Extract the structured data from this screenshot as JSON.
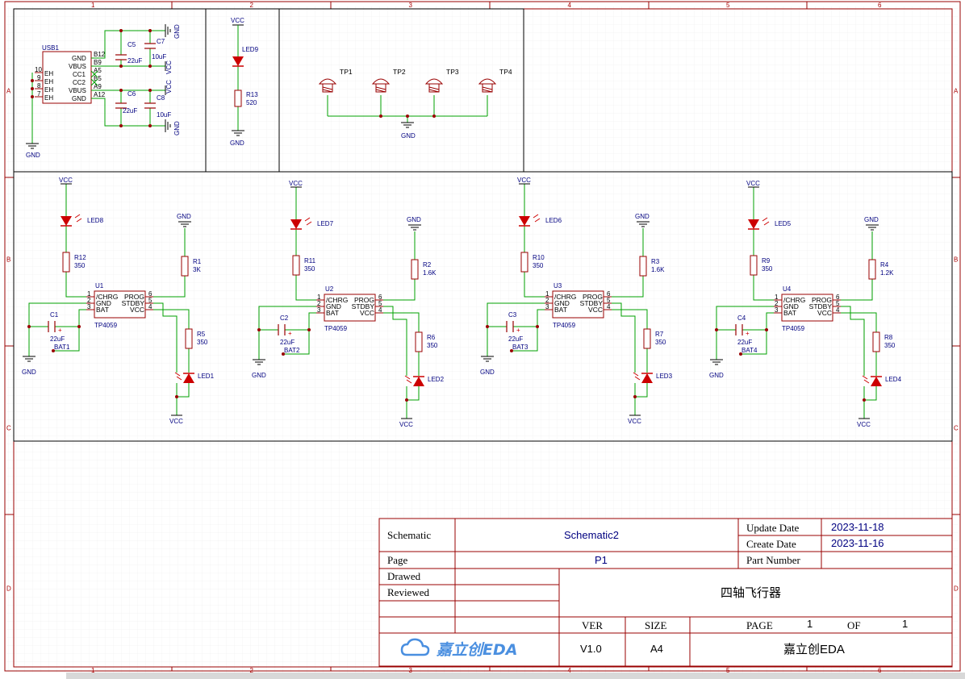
{
  "grid": {
    "columns": [
      "1",
      "2",
      "3",
      "4",
      "5",
      "6"
    ],
    "rows": [
      "A",
      "B",
      "C",
      "D"
    ]
  },
  "power_labels": {
    "vcc": "VCC",
    "gnd": "GND"
  },
  "usb": {
    "ref": "USB1",
    "left_pins": [
      "10",
      "9",
      "8",
      "7"
    ],
    "left_names": [
      "EH",
      "EH",
      "EH",
      "EH"
    ],
    "inner_names": [
      "GND",
      "VBUS",
      "CC1",
      "CC2",
      "VBUS",
      "GND"
    ],
    "right_pins": [
      "B12",
      "B9",
      "A5",
      "B5",
      "A9",
      "A12"
    ],
    "caps": [
      {
        "ref": "C5",
        "value": "22uF"
      },
      {
        "ref": "C7",
        "value": "10uF"
      },
      {
        "ref": "C6",
        "value": "22uF"
      },
      {
        "ref": "C8",
        "value": "10uF"
      }
    ]
  },
  "led9": {
    "ref": "LED9",
    "r_ref": "R13",
    "r_value": "520"
  },
  "test_points": [
    "TP1",
    "TP2",
    "TP3",
    "TP4"
  ],
  "chargers": [
    {
      "u": "U1",
      "led_top": "LED8",
      "r_led": "R12",
      "r_led_v": "350",
      "r_prog": "R1",
      "r_prog_v": "3K",
      "cap": "C1",
      "cap_v": "22uF",
      "bat": "BAT1",
      "r_stdby": "R5",
      "r_stdby_v": "350",
      "led_bot": "LED1",
      "part": "TP4059"
    },
    {
      "u": "U2",
      "led_top": "LED7",
      "r_led": "R11",
      "r_led_v": "350",
      "r_prog": "R2",
      "r_prog_v": "1.6K",
      "cap": "C2",
      "cap_v": "22uF",
      "bat": "BAT2",
      "r_stdby": "R6",
      "r_stdby_v": "350",
      "led_bot": "LED2",
      "part": "TP4059"
    },
    {
      "u": "U3",
      "led_top": "LED6",
      "r_led": "R10",
      "r_led_v": "350",
      "r_prog": "R3",
      "r_prog_v": "1.6K",
      "cap": "C3",
      "cap_v": "22uF",
      "bat": "BAT3",
      "r_stdby": "R7",
      "r_stdby_v": "350",
      "led_bot": "LED3",
      "part": "TP4059"
    },
    {
      "u": "U4",
      "led_top": "LED5",
      "r_led": "R9",
      "r_led_v": "350",
      "r_prog": "R4",
      "r_prog_v": "1.2K",
      "cap": "C4",
      "cap_v": "22uF",
      "bat": "BAT4",
      "r_stdby": "R8",
      "r_stdby_v": "350",
      "led_bot": "LED4",
      "part": "TP4059"
    }
  ],
  "ic_pins": {
    "left_nums": [
      "1",
      "2",
      "3"
    ],
    "left_names": [
      "/CHRG",
      "GND",
      "BAT"
    ],
    "right_names": [
      "PROG",
      "STDBY",
      "VCC"
    ],
    "right_nums": [
      "6",
      "5",
      "4"
    ]
  },
  "title_block": {
    "schematic_label": "Schematic",
    "schematic_value": "Schematic2",
    "page_label": "Page",
    "page_value": "P1",
    "drawed_label": "Drawed",
    "reviewed_label": "Reviewed",
    "update_label": "Update Date",
    "update_value": "2023-11-18",
    "create_label": "Create Date",
    "create_value": "2023-11-16",
    "part_label": "Part Number",
    "part_value": "",
    "project_title": "四轴飞行器",
    "ver_label": "VER",
    "ver_value": "V1.0",
    "size_label": "SIZE",
    "size_value": "A4",
    "page_of_label": "PAGE",
    "page_num": "1",
    "of_label": "OF",
    "page_total": "1",
    "logo_text": "嘉立创EDA",
    "company": "嘉立创EDA"
  },
  "colors": {
    "frame": "#990000",
    "wire": "#00a000",
    "text": "#000080",
    "component": "#990000",
    "led": "#cc0000"
  }
}
